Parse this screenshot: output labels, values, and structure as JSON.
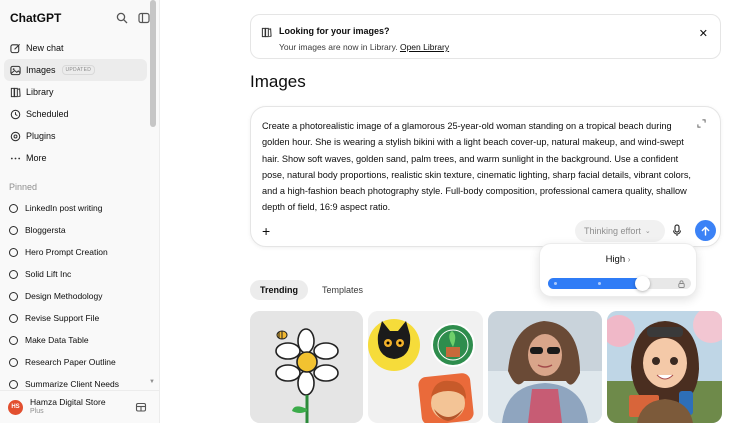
{
  "sidebar": {
    "brand": "ChatGPT",
    "nav": [
      {
        "label": "New chat",
        "icon": "new-chat-icon"
      },
      {
        "label": "Images",
        "icon": "images-icon",
        "badge": "UPDATED",
        "active": true
      },
      {
        "label": "Library",
        "icon": "library-icon"
      },
      {
        "label": "Scheduled",
        "icon": "scheduled-icon"
      },
      {
        "label": "Plugins",
        "icon": "plugins-icon"
      },
      {
        "label": "More",
        "icon": "more-icon"
      }
    ],
    "pinned_label": "Pinned",
    "pinned": [
      "LinkedIn post writing",
      "Bloggersta",
      "Hero Prompt Creation",
      "Solid Lift Inc",
      "Design Methodology",
      "Revise Support File",
      "Make Data Table",
      "Research Paper Outline",
      "Summarize Client Needs"
    ],
    "user": {
      "initials": "HS",
      "name": "Hamza Digital Store",
      "plan": "Plus"
    }
  },
  "banner": {
    "title": "Looking for your images?",
    "text": "Your images are now in Library.",
    "link": "Open Library"
  },
  "main": {
    "title": "Images",
    "prompt": "Create a photorealistic image of a glamorous 25-year-old woman standing on a tropical beach during golden hour. She is wearing a stylish bikini with a light beach cover-up, natural makeup, and wind-swept hair. Show soft waves, golden sand, palm trees, and warm sunlight in the background. Use a confident pose, natural body proportions, realistic skin texture, cinematic lighting, sharp facial details, vibrant colors, and a high-fashion beach photography style. Full-body composition, professional camera quality, shallow depth of field, 16:9 aspect ratio.",
    "thinking_label": "Thinking effort",
    "effort": {
      "label": "High",
      "level": 0.66
    },
    "tabs": [
      "Trending",
      "Templates"
    ],
    "accent_color": "#2f7cf6"
  }
}
